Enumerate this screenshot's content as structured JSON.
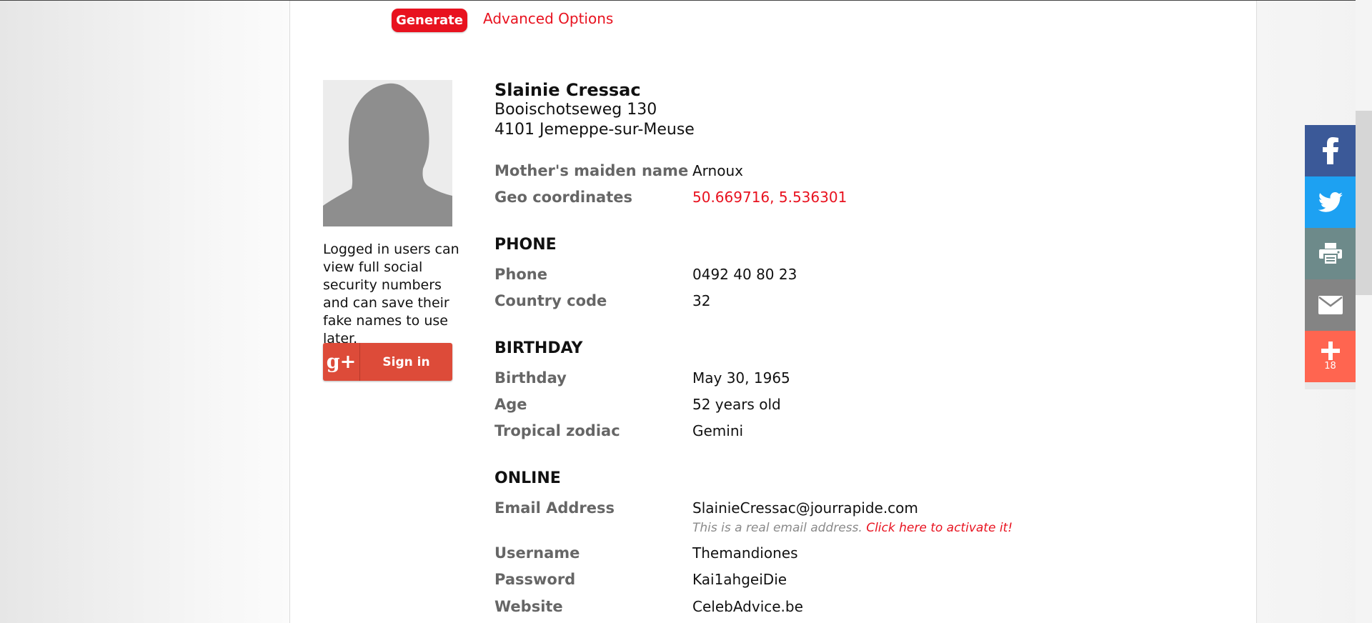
{
  "toolbar": {
    "generate_label": "Generate",
    "advanced_label": "Advanced Options"
  },
  "sidebar": {
    "login_note": "Logged in users can view full social security numbers and can save their fake names to use later.",
    "gplus_icon": "g+",
    "signin_label": "Sign in"
  },
  "person": {
    "name": "Slainie Cressac",
    "street": "Booischotseweg 130",
    "city": "4101 Jemeppe-sur-Meuse"
  },
  "details": [
    {
      "label": "Mother's maiden name",
      "value": "Arnoux"
    },
    {
      "label": "Geo coordinates",
      "value": "50.669716, 5.536301"
    }
  ],
  "phone": {
    "heading": "PHONE",
    "rows": [
      {
        "label": "Phone",
        "value": "0492 40 80 23"
      },
      {
        "label": "Country code",
        "value": "32"
      }
    ]
  },
  "birthday": {
    "heading": "BIRTHDAY",
    "rows": [
      {
        "label": "Birthday",
        "value": "May 30, 1965"
      },
      {
        "label": "Age",
        "value": "52 years old"
      },
      {
        "label": "Tropical zodiac",
        "value": "Gemini"
      }
    ]
  },
  "online": {
    "heading": "ONLINE",
    "email_label": "Email Address",
    "email": "SlainieCressac@jourrapide.com",
    "email_note": "This is a real email address. ",
    "email_activate": "Click here to activate it!",
    "rows": [
      {
        "label": "Username",
        "value": "Themandiones"
      },
      {
        "label": "Password",
        "value": "Kai1ahgeiDie"
      },
      {
        "label": "Website",
        "value": "CelebAdvice.be"
      }
    ]
  },
  "share": {
    "icons": [
      "facebook-icon",
      "twitter-icon",
      "print-icon",
      "email-icon",
      "plus-icon"
    ],
    "count": "18",
    "colors": {
      "facebook": "#3b5998",
      "twitter": "#1da1f2",
      "print": "#6d8a8a",
      "email": "#848484",
      "more": "#ff6550"
    }
  },
  "colors": {
    "accent": "#e8121f",
    "label_gray": "#666666"
  }
}
